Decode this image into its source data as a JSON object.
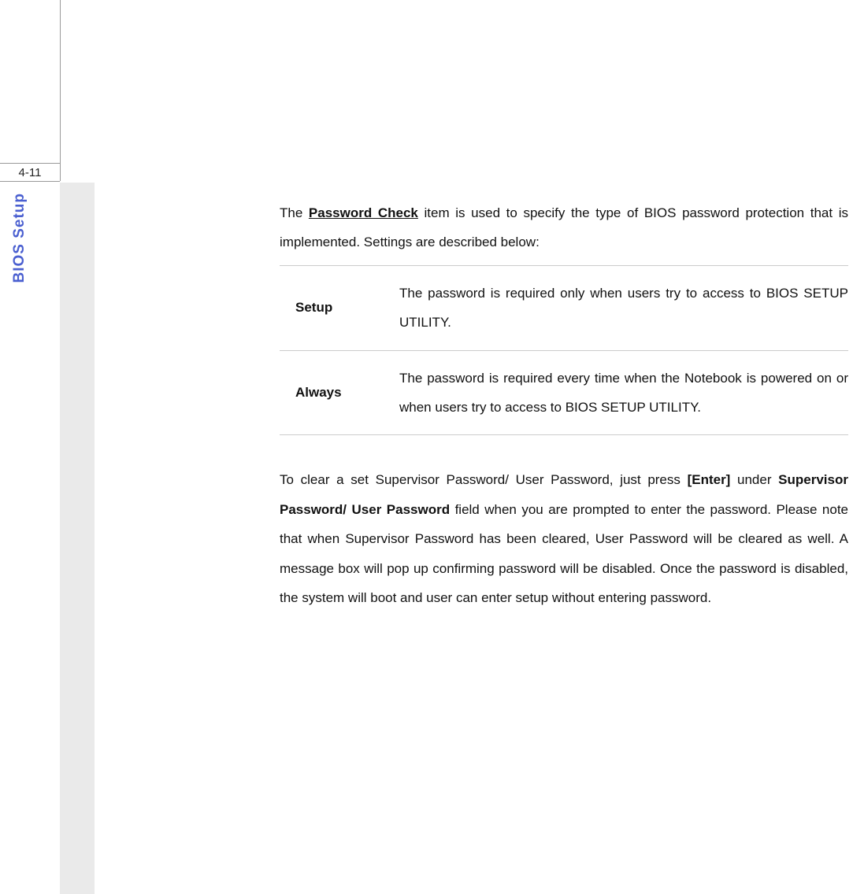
{
  "page": {
    "number": "4-11",
    "sidebar_title": "BIOS Setup"
  },
  "content": {
    "intro": {
      "pre": "The ",
      "item_name": "Password Check",
      "post": " item is used to specify the type of BIOS password protection that is implemented.   Settings are described below:"
    },
    "table": {
      "rows": [
        {
          "label": "Setup",
          "desc": "The password is required only when users try to access to BIOS SETUP UTILITY."
        },
        {
          "label": "Always",
          "desc": "The password is required every time when the Notebook is powered on or when users try to access to BIOS SETUP UTILITY."
        }
      ]
    },
    "after": {
      "pre": "To clear a set Supervisor Password/ User Password, just press ",
      "enter_key": "[Enter]",
      "mid1": " under ",
      "field_name": "Supervisor Password/ User Password",
      "post": " field when you are prompted to enter the password.   Please note that when Supervisor Password has been cleared, User Password will be cleared as well. A message box will pop up confirming password will be disabled.   Once the password is disabled, the system will boot and user can enter setup without entering password."
    }
  }
}
